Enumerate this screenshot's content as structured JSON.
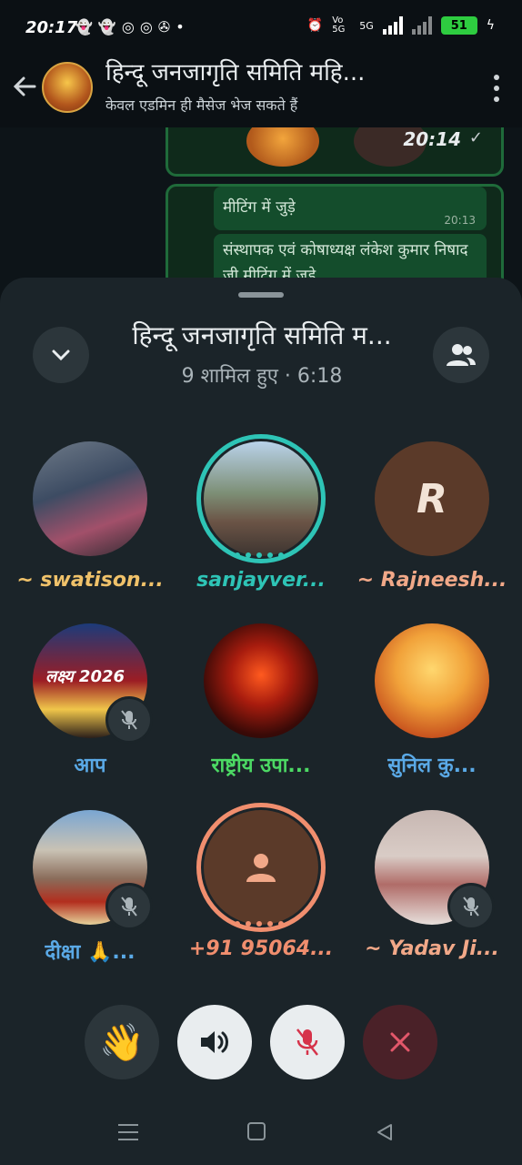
{
  "status_bar": {
    "time": "20:17",
    "network": "5G",
    "volte": "Vo 5G",
    "battery": "51"
  },
  "chat_header": {
    "title": "हिन्दू जनजागृति समिति महि...",
    "subtitle": "केवल एडमिन ही मैसेज भेज सकते हैं"
  },
  "chat_preview": {
    "top_time": "20:14",
    "message1": "मीटिंग में जुड़े",
    "message1_time": "20:13",
    "message2": "संस्थापक एवं कोषाध्यक्ष लंकेश कुमार निषाद जी मीटिंग में जुड़े"
  },
  "call": {
    "title": "हिन्दू जनजागृति समिति म...",
    "subtitle": "9 शामिल हुए · 6:18"
  },
  "participants": [
    {
      "name": "~ swatison...",
      "color": "#f0c26a",
      "muted": false,
      "speaking": false
    },
    {
      "name": "sanjayver...",
      "color": "#2ec4b6",
      "muted": false,
      "speaking": true
    },
    {
      "name": "~ Rajneesh...",
      "color": "#f1a888",
      "muted": false,
      "speaking": false,
      "initial": "R"
    },
    {
      "name": "आप",
      "color": "#5aa9e6",
      "muted": true,
      "speaking": false
    },
    {
      "name": "राष्ट्रीय उपा...",
      "color": "#4cd964",
      "muted": false,
      "speaking": false
    },
    {
      "name": "सुनिल कु...",
      "color": "#5aa9e6",
      "muted": false,
      "speaking": false
    },
    {
      "name": "दीक्षा 🙏...",
      "color": "#5aa9e6",
      "muted": true,
      "speaking": false
    },
    {
      "name": "+91 95064...",
      "color": "#f08e6e",
      "muted": false,
      "speaking": true
    },
    {
      "name": "~ Yadav Ji...",
      "color": "#f1a888",
      "muted": true,
      "speaking": false
    }
  ],
  "avatar_texts": {
    "p4_banner": "लक्ष्य 2026"
  },
  "controls": {
    "wave_icon": "waving-hand",
    "speaker_icon": "speaker-icon",
    "mic_icon": "mic-off-icon",
    "end_icon": "close-icon"
  }
}
